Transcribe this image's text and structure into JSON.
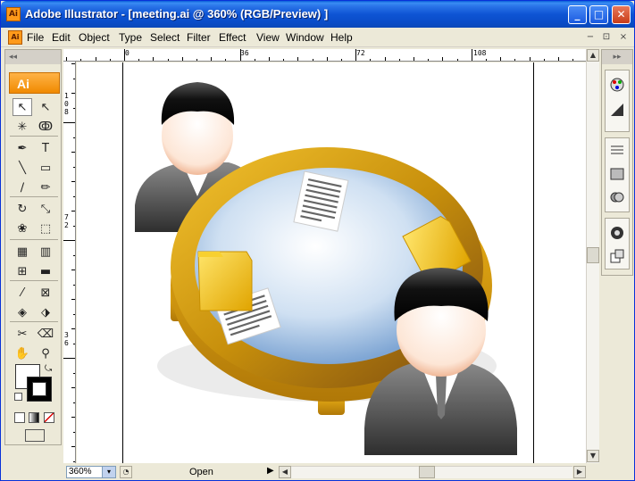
{
  "window": {
    "title": "Adobe Illustrator - [meeting.ai @ 360% (RGB/Preview) ]",
    "app_icon_label": "Ai",
    "controls": {
      "minimize": "_",
      "maximize": "□",
      "close": "✕"
    }
  },
  "menubar": {
    "items": [
      "File",
      "Edit",
      "Object",
      "Type",
      "Select",
      "Filter",
      "Effect",
      "View",
      "Window",
      "Help"
    ],
    "mdi": {
      "minimize": "−",
      "restore": "⊡",
      "close": "×"
    }
  },
  "toolbox": {
    "collapse_label": "◂◂",
    "logo": "Ai",
    "tools": [
      {
        "name": "selection-tool",
        "glyph": "↖"
      },
      {
        "name": "direct-selection-tool",
        "glyph": "↖"
      },
      {
        "name": "magic-wand-tool",
        "glyph": "✳"
      },
      {
        "name": "lasso-tool",
        "glyph": "ↂ"
      },
      {
        "name": "pen-tool",
        "glyph": "✒"
      },
      {
        "name": "type-tool",
        "glyph": "T"
      },
      {
        "name": "line-segment-tool",
        "glyph": "╲"
      },
      {
        "name": "rectangle-tool",
        "glyph": "▭"
      },
      {
        "name": "paintbrush-tool",
        "glyph": "∕"
      },
      {
        "name": "pencil-tool",
        "glyph": "✏"
      },
      {
        "name": "rotate-tool",
        "glyph": "↻"
      },
      {
        "name": "scale-tool",
        "glyph": "⤡"
      },
      {
        "name": "warp-tool",
        "glyph": "❀"
      },
      {
        "name": "free-transform-tool",
        "glyph": "⬚"
      },
      {
        "name": "symbol-sprayer-tool",
        "glyph": "▦"
      },
      {
        "name": "column-graph-tool",
        "glyph": "▥"
      },
      {
        "name": "mesh-tool",
        "glyph": "⊞"
      },
      {
        "name": "gradient-tool",
        "glyph": "▬"
      },
      {
        "name": "eyedropper-tool",
        "glyph": "⁄"
      },
      {
        "name": "blend-tool",
        "glyph": "⊠"
      },
      {
        "name": "live-paint-bucket-tool",
        "glyph": "◈"
      },
      {
        "name": "live-paint-selection-tool",
        "glyph": "⬗"
      },
      {
        "name": "slice-tool",
        "glyph": "✂"
      },
      {
        "name": "eraser-tool",
        "glyph": "⌫"
      },
      {
        "name": "hand-tool",
        "glyph": "✋"
      },
      {
        "name": "zoom-tool",
        "glyph": "⚲"
      }
    ]
  },
  "rulers": {
    "top": [
      "0",
      "36",
      "72",
      "108"
    ],
    "left": [
      "108",
      "72",
      "36"
    ]
  },
  "status": {
    "zoom": "360%",
    "zoom_dropdown": "▾",
    "info": "Open",
    "arrow": "▶"
  },
  "scroll": {
    "up": "▲",
    "down": "▼",
    "left": "◀",
    "right": "▶"
  },
  "dock": {
    "collapse_label": "▸▸",
    "icons": [
      "color-palette-icon",
      "stroke-icon",
      "gradient-icon",
      "transparency-icon",
      "appearance-icon",
      "graphic-styles-icon",
      "symbols-icon"
    ]
  },
  "colors": {
    "title_blue": "#0e54d4",
    "chrome": "#ece9d8",
    "ai_orange": "#f08a00",
    "table_gold": "#d8a010",
    "table_glass": "#bcd4ee",
    "folder_yellow": "#f6c818",
    "suit_gray": "#4a4a4a"
  }
}
